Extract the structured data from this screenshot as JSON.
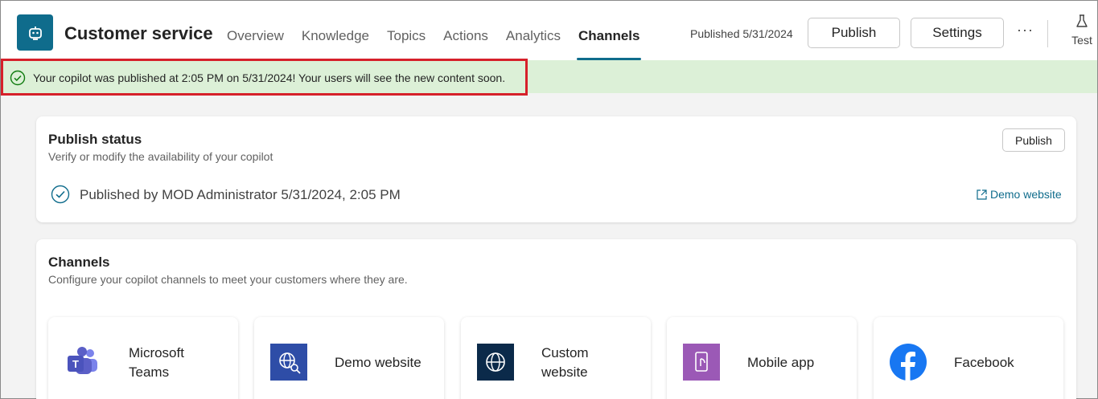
{
  "header": {
    "app_title": "Customer service",
    "tabs": [
      {
        "label": "Overview"
      },
      {
        "label": "Knowledge"
      },
      {
        "label": "Topics"
      },
      {
        "label": "Actions"
      },
      {
        "label": "Analytics"
      },
      {
        "label": "Channels",
        "active": true
      }
    ],
    "published_text": "Published 5/31/2024",
    "publish_label": "Publish",
    "settings_label": "Settings",
    "more_label": "···",
    "test_label": "Test"
  },
  "banner": {
    "message": "Your copilot was published at 2:05 PM on 5/31/2024! Your users will see the new content soon.",
    "color": "#dcf0d7",
    "highlight_color": "#d6202a"
  },
  "publish_status": {
    "title": "Publish status",
    "subtitle": "Verify or modify the availability of your copilot",
    "status": "Published by MOD Administrator 5/31/2024, 2:05 PM",
    "publish_label": "Publish",
    "link_label": "Demo website"
  },
  "channels": {
    "title": "Channels",
    "subtitle": "Configure your copilot channels to meet your customers where they are.",
    "items": [
      {
        "label_line1": "Microsoft",
        "label_line2": "Teams",
        "icon": "teams-icon"
      },
      {
        "label_line1": "Demo website",
        "icon": "demo-website-icon"
      },
      {
        "label_line1": "Custom",
        "label_line2": "website",
        "icon": "globe-icon"
      },
      {
        "label_line1": "Mobile app",
        "icon": "mobile-app-icon"
      },
      {
        "label_line1": "Facebook",
        "icon": "facebook-icon"
      }
    ]
  },
  "colors": {
    "accent": "#0f6c8c",
    "teams": "#5b5fc7",
    "demo": "#2e4da7",
    "custom": "#0b2a4a",
    "mobile": "#9b59b6",
    "facebook": "#1877f2"
  }
}
